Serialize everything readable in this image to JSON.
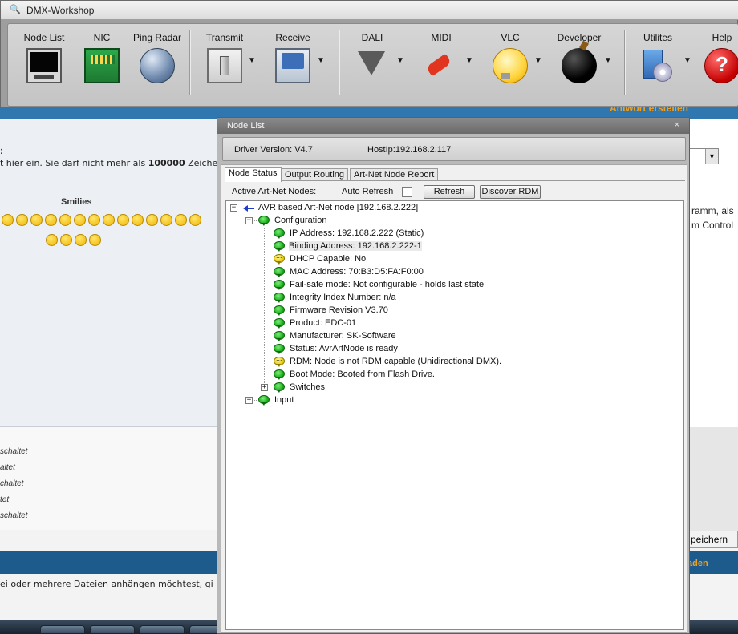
{
  "app": {
    "title": "DMX-Workshop",
    "title_icon": "magnifier-icon"
  },
  "toolbar": [
    {
      "label": "Node List",
      "icon": "monitor-icon",
      "dropdown": false
    },
    {
      "label": "NIC",
      "icon": "network-card-icon",
      "dropdown": false
    },
    {
      "label": "Ping Radar",
      "icon": "globe-icon",
      "dropdown": false
    },
    {
      "label": "Transmit",
      "icon": "switch-icon",
      "dropdown": true
    },
    {
      "label": "Receive",
      "icon": "scope-icon",
      "dropdown": true
    },
    {
      "label": "DALI",
      "icon": "funnel-icon",
      "dropdown": true
    },
    {
      "label": "MIDI",
      "icon": "guitar-icon",
      "dropdown": true
    },
    {
      "label": "VLC",
      "icon": "lightbulb-icon",
      "dropdown": true
    },
    {
      "label": "Developer",
      "icon": "bomb-icon",
      "dropdown": true
    },
    {
      "label": "Utilites",
      "icon": "disc-icon",
      "dropdown": true
    },
    {
      "label": "Help",
      "icon": "help-icon",
      "dropdown": false
    }
  ],
  "background": {
    "antwort": "Antwort erstellen",
    "text_colon": ":",
    "text_limit_a": "t hier ein. Sie darf nicht mehr als ",
    "text_limit_b": "100000",
    "text_limit_c": " Zeiche",
    "smilies_title": "Smilies",
    "schaltet": [
      "schaltet",
      "altet",
      "chaltet",
      "tet",
      "schaltet"
    ],
    "right_text_1": "ramm, als",
    "right_text_2": "m Control",
    "speichern": "peichern",
    "laden": "aden",
    "hint": "ei oder mehrere Dateien anhängen möchtest, gi",
    "colors": {
      "forum_blue": "#1d5b8c",
      "forum_orange": "#f0a020"
    }
  },
  "nodelist": {
    "title": "Node List",
    "close": "×",
    "driver_version": "Driver Version: V4.7",
    "host_ip": "HostIp:192.168.2.117",
    "tabs": [
      "Node Status",
      "Output Routing",
      "Art-Net Node Report"
    ],
    "active_nodes_label": "Active Art-Net Nodes:",
    "auto_refresh_label": "Auto Refresh",
    "auto_refresh_checked": false,
    "refresh_button": "Refresh",
    "discover_button": "Discover RDM",
    "tree": {
      "root": {
        "expander": "−",
        "text": "AVR based Art-Net node [192.168.2.222]"
      },
      "configuration": {
        "expander": "−",
        "text": "Configuration"
      },
      "items": [
        {
          "text": "IP Address: 192.168.2.222 (Static)",
          "status": "ok"
        },
        {
          "text": "Binding Address: 192.168.2.222-1",
          "status": "ok",
          "highlight": true
        },
        {
          "text": "DHCP Capable: No",
          "status": "warn"
        },
        {
          "text": "MAC Address: 70:B3:D5:FA:F0:00",
          "status": "ok"
        },
        {
          "text": "Fail-safe mode: Not configurable - holds last state",
          "status": "ok"
        },
        {
          "text": "Integrity Index Number: n/a",
          "status": "ok"
        },
        {
          "text": "Firmware Revision V3.70",
          "status": "ok"
        },
        {
          "text": "Product: EDC-01",
          "status": "ok"
        },
        {
          "text": "Manufacturer: SK-Software",
          "status": "ok"
        },
        {
          "text": "Status: AvrArtNode is ready",
          "status": "ok"
        },
        {
          "text": "RDM: Node is not RDM capable (Unidirectional DMX).",
          "status": "warn"
        },
        {
          "text": "Boot Mode: Booted from Flash Drive.",
          "status": "ok"
        }
      ],
      "switches": {
        "expander": "+",
        "text": "Switches"
      },
      "input": {
        "expander": "+",
        "text": "Input"
      }
    }
  }
}
